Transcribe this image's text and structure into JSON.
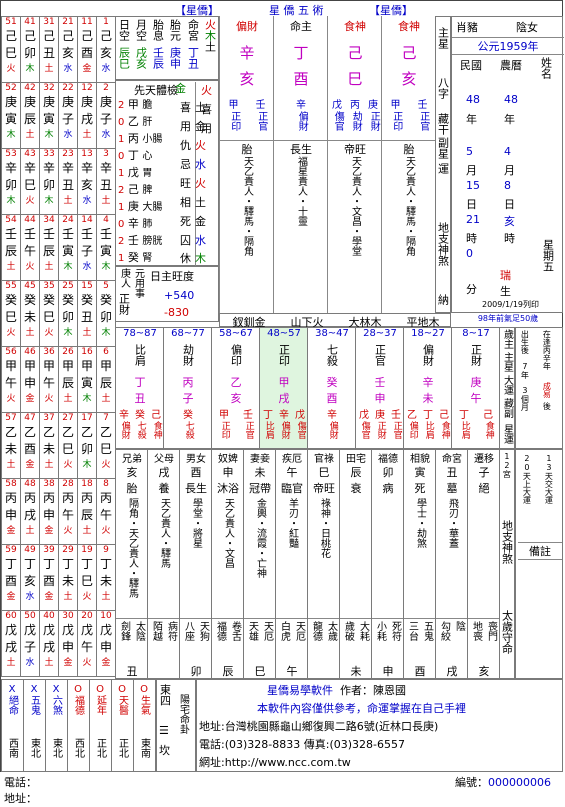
{
  "header": {
    "left_tag": "【星僑】",
    "title": "星  僑  五  術",
    "right_tag": "【星僑】"
  },
  "year_columns": [
    {
      "num": "51",
      "stem": "己",
      "branch": "巳",
      "el": "火"
    },
    {
      "num": "41",
      "stem": "己",
      "branch": "卯",
      "el": "木"
    },
    {
      "num": "31",
      "stem": "己",
      "branch": "丑",
      "el": "土"
    },
    {
      "num": "21",
      "stem": "己",
      "branch": "亥",
      "el": "水"
    },
    {
      "num": "11",
      "stem": "己",
      "branch": "酉",
      "el": "金"
    },
    {
      "num": "1",
      "stem": "己",
      "branch": "亥",
      "el": "水"
    }
  ],
  "left_grid": [
    [
      [
        "52",
        "庚",
        "寅",
        "木"
      ],
      [
        "42",
        "庚",
        "辰",
        "土"
      ],
      [
        "32",
        "庚",
        "寅",
        "木"
      ],
      [
        "22",
        "庚",
        "子",
        "水"
      ],
      [
        "12",
        "庚",
        "戌",
        "土"
      ],
      [
        "2",
        "庚",
        "子",
        "水"
      ]
    ],
    [
      [
        "53",
        "辛",
        "卯",
        "木"
      ],
      [
        "43",
        "辛",
        "巳",
        "火"
      ],
      [
        "33",
        "辛",
        "卯",
        "木"
      ],
      [
        "23",
        "辛",
        "丑",
        "土"
      ],
      [
        "13",
        "辛",
        "亥",
        "水"
      ],
      [
        "3",
        "辛",
        "丑",
        "土"
      ]
    ],
    [
      [
        "54",
        "壬",
        "辰",
        "土"
      ],
      [
        "44",
        "壬",
        "午",
        "火"
      ],
      [
        "34",
        "壬",
        "辰",
        "土"
      ],
      [
        "24",
        "壬",
        "寅",
        "木"
      ],
      [
        "14",
        "壬",
        "子",
        "水"
      ],
      [
        "4",
        "壬",
        "寅",
        "木"
      ]
    ],
    [
      [
        "55",
        "癸",
        "巳",
        "火"
      ],
      [
        "45",
        "癸",
        "未",
        "土"
      ],
      [
        "35",
        "癸",
        "巳",
        "火"
      ],
      [
        "25",
        "癸",
        "卯",
        "木"
      ],
      [
        "15",
        "癸",
        "丑",
        "土"
      ],
      [
        "5",
        "癸",
        "卯",
        "木"
      ]
    ],
    [
      [
        "56",
        "甲",
        "午",
        "火"
      ],
      [
        "46",
        "甲",
        "申",
        "金"
      ],
      [
        "36",
        "甲",
        "午",
        "火"
      ],
      [
        "26",
        "甲",
        "辰",
        "土"
      ],
      [
        "16",
        "甲",
        "寅",
        "木"
      ],
      [
        "6",
        "甲",
        "辰",
        "土"
      ]
    ],
    [
      [
        "57",
        "乙",
        "未",
        "土"
      ],
      [
        "47",
        "乙",
        "酉",
        "金"
      ],
      [
        "37",
        "乙",
        "未",
        "土"
      ],
      [
        "27",
        "乙",
        "巳",
        "火"
      ],
      [
        "17",
        "乙",
        "卯",
        "木"
      ],
      [
        "7",
        "乙",
        "巳",
        "火"
      ]
    ],
    [
      [
        "58",
        "丙",
        "申",
        "金"
      ],
      [
        "48",
        "丙",
        "戌",
        "土"
      ],
      [
        "38",
        "丙",
        "申",
        "金"
      ],
      [
        "28",
        "丙",
        "午",
        "火"
      ],
      [
        "18",
        "丙",
        "辰",
        "土"
      ],
      [
        "8",
        "丙",
        "午",
        "火"
      ]
    ],
    [
      [
        "59",
        "丁",
        "酉",
        "金"
      ],
      [
        "49",
        "丁",
        "亥",
        "水"
      ],
      [
        "39",
        "丁",
        "酉",
        "金"
      ],
      [
        "29",
        "丁",
        "未",
        "土"
      ],
      [
        "19",
        "丁",
        "巳",
        "火"
      ],
      [
        "9",
        "丁",
        "未",
        "土"
      ]
    ],
    [
      [
        "60",
        "戊",
        "戌",
        "土"
      ],
      [
        "50",
        "戊",
        "子",
        "水"
      ],
      [
        "40",
        "戊",
        "戌",
        "土"
      ],
      [
        "30",
        "戊",
        "申",
        "金"
      ],
      [
        "20",
        "戊",
        "午",
        "火"
      ],
      [
        "10",
        "戊",
        "申",
        "金"
      ]
    ]
  ],
  "info_cols": {
    "rikong": "日空",
    "rikong_vals": "辰巳",
    "yuekong": "月空",
    "yuekong_vals": "戌亥",
    "taixi": "胎息",
    "taixi_vals": "壬辰",
    "taiyuan": "胎元",
    "taiyuan_vals": "庚申",
    "minggong": "命宮",
    "minggong_vals": "丁丑"
  },
  "wuxing": [
    {
      "e": "火",
      "n": ""
    },
    {
      "e": "木",
      "n": ""
    },
    {
      "e": "土",
      "n": ""
    },
    {
      "e": "水",
      "n": ""
    },
    {
      "e": "金",
      "n": ""
    }
  ],
  "xiantian": {
    "title": "先天體檢",
    "stems": [
      "甲",
      "乙",
      "丙",
      "丁",
      "戊",
      "己",
      "庚",
      "辛",
      "壬",
      "癸"
    ],
    "nums": [
      "2",
      "0",
      "1",
      "0",
      "1",
      "2",
      "1",
      "0",
      "2",
      "1"
    ],
    "organs": [
      "膽",
      "肝",
      "小腸",
      "心",
      "胃",
      "脾",
      "大腸",
      "肺",
      "膀胱",
      "腎"
    ]
  },
  "xiji": {
    "xi": "喜",
    "yong": "用",
    "chou": "仇",
    "ji": "忌",
    "xi_e": "土",
    "yong_e": "金",
    "chou_e": "火",
    "ji_e": "水"
  },
  "wangxiang": {
    "wang": "旺",
    "xiang": "相",
    "si": "死",
    "qiu": "囚",
    "xiu": "休",
    "wang_e": "火",
    "xiang_e": "土",
    "si_e": "金",
    "qiu_e": "水",
    "xiu_e": "木"
  },
  "yuanyong": {
    "label1": "庚",
    "label2": "人",
    "label3": "元",
    "label4": "用",
    "label5": "事"
  },
  "rizhu": {
    "title": "日主旺度",
    "plus": "+540",
    "minus": "-830",
    "zhengcai": "正財"
  },
  "pillars": [
    {
      "god": "偏財",
      "stem": "辛",
      "branch": "亥",
      "god_color": "red",
      "hidden": [
        [
          "甲",
          "正印"
        ],
        [
          "壬",
          "正官"
        ]
      ],
      "stage": "胎",
      "stars": [
        "天乙貴人",
        "驛馬",
        "隔角"
      ]
    },
    {
      "god": "命主",
      "stem": "丁",
      "branch": "酉",
      "god_color": "black",
      "hidden": [
        [
          "辛",
          "偏財"
        ]
      ],
      "stage": "長生",
      "stars": [
        "福星貴人",
        "十靈"
      ]
    },
    {
      "god": "食神",
      "stem": "己",
      "branch": "巳",
      "god_color": "red",
      "hidden": [
        [
          "戊",
          "傷官"
        ],
        [
          "丙",
          "劫財"
        ],
        [
          "庚",
          "正財"
        ]
      ],
      "stage": "帝旺",
      "stars": [
        "天乙貴人",
        "文昌",
        "學堂"
      ]
    },
    {
      "god": "食神",
      "stem": "己",
      "branch": "亥",
      "god_color": "red",
      "hidden": [
        [
          "甲",
          "正印"
        ],
        [
          "壬",
          "正官"
        ]
      ],
      "stage": "胎",
      "stars": [
        "天乙貴人",
        "驛馬",
        "隔角"
      ]
    }
  ],
  "side_labels": {
    "zhuxing": "主星",
    "bazi": "八字",
    "canggan": "藏干",
    "fuxing": "副星",
    "yun": "運",
    "shensha": "地支神煞",
    "nayin": "納"
  },
  "nayin": [
    "釵釧金",
    "山下火",
    "大林木",
    "平地木"
  ],
  "person": {
    "shengxiao": "肖豬",
    "gender": "陰女",
    "year_ce": "公元1959年",
    "minguo": "民國",
    "nongli": "農曆",
    "name": "姓名",
    "mg_year": "48",
    "mg_nian": "年",
    "mg_month": "5",
    "mg_yue": "月",
    "mg_day": "15",
    "mg_ri": "日",
    "mg_hour": "21",
    "mg_shi": "時",
    "mg_min": "0",
    "mg_fen": "分",
    "nl_year": "48",
    "nl_nian": "年",
    "nl_month": "4",
    "nl_yue": "月",
    "nl_day": "8",
    "nl_ri": "日",
    "nl_hour": "亥",
    "nl_shi": "時",
    "rui": "瑞",
    "sheng": "生",
    "xingqi": "星期五",
    "date": "2009/1/19列印",
    "jieqi": "98年前氣足50歲"
  },
  "dayun": [
    {
      "age": "78~87",
      "god": "比肩",
      "stem": "丁",
      "branch": "丑",
      "hidden": [
        [
          "辛",
          "偏財"
        ],
        [
          "癸",
          "七殺"
        ],
        [
          "己",
          "食神"
        ]
      ],
      "stage": "墓",
      "stars": [
        "天乙貴人",
        "驛馬"
      ],
      "hl": false
    },
    {
      "age": "68~77",
      "god": "劫財",
      "stem": "丙",
      "branch": "子",
      "hidden": [
        [
          "癸",
          "七殺"
        ]
      ],
      "stage": "絕",
      "stars": [
        "天德"
      ],
      "hl": false
    },
    {
      "age": "58~67",
      "god": "偏印",
      "stem": "乙",
      "branch": "亥",
      "hidden": [
        [
          "甲",
          "正印"
        ],
        [
          "壬",
          "正官"
        ]
      ],
      "stage": "胎",
      "stars": [
        "天德",
        "天乙貴人"
      ],
      "hl": false
    },
    {
      "age": "48~57",
      "god": "正印",
      "stem": "甲",
      "branch": "戌",
      "hidden": [
        [
          "丁",
          "比肩"
        ],
        [
          "辛",
          "偏財"
        ],
        [
          "戊",
          "傷官"
        ]
      ],
      "stage": "養",
      "stars": [
        "福星",
        "十靈"
      ],
      "hl": true
    },
    {
      "age": "38~47",
      "god": "七殺",
      "stem": "癸",
      "branch": "酉",
      "hidden": [
        [
          "辛",
          "偏財"
        ]
      ],
      "stage": "長生",
      "stars": [
        "文昌",
        "學堂"
      ],
      "hl": false
    },
    {
      "age": "28~37",
      "god": "正官",
      "stem": "壬",
      "branch": "申",
      "hidden": [
        [
          "戊",
          "傷官"
        ],
        [
          "庚",
          "正財"
        ],
        [
          "壬",
          "正官"
        ]
      ],
      "stage": "沐浴",
      "stars": [
        "天乙貴人"
      ],
      "hl": false
    },
    {
      "age": "18~27",
      "god": "偏財",
      "stem": "辛",
      "branch": "未",
      "hidden": [
        [
          "乙",
          "偏印"
        ],
        [
          "丁",
          "比肩"
        ],
        [
          "己",
          "食神"
        ]
      ],
      "stage": "冠帶",
      "stars": [
        "驛馬"
      ],
      "hl": false
    },
    {
      "age": "8~17",
      "god": "正財",
      "stem": "庚",
      "branch": "午",
      "hidden": [
        [
          "丁",
          "比肩"
        ],
        [
          "己",
          "食神"
        ]
      ],
      "stage": "臨官",
      "stars": [
        "天德"
      ],
      "hl": false
    }
  ],
  "dayun_side": {
    "suizhu": "歲主",
    "zhuxing": "主星",
    "dayun": "大運",
    "canggan": "藏副",
    "yun": "星運"
  },
  "birth_info": {
    "col1": "出生後",
    "col1b": "7年",
    "col1c": "3個月",
    "col1d": "20天上大運",
    "col2": "在逢丙辛年",
    "col2b": "成易",
    "col2c": "後",
    "col2d": "13天交大運"
  },
  "palaces": [
    {
      "name": "兄弟",
      "branch": "亥",
      "stage": "胎",
      "stars": [
        "隔角",
        "天乙貴人",
        "驛馬"
      ],
      "bottom": [
        "劍鋒",
        "太陰"
      ],
      "b2": "丑"
    },
    {
      "name": "父母",
      "branch": "戌",
      "stage": "養",
      "stars": [
        "天乙貴人",
        "驛馬"
      ],
      "bottom": [
        "陌越",
        "病符"
      ],
      "b2": ""
    },
    {
      "name": "男女",
      "branch": "酉",
      "stage": "長生",
      "stars": [
        "學堂",
        "將星"
      ],
      "bottom": [
        "八座",
        "天狗"
      ],
      "b2": "卯"
    },
    {
      "name": "奴婢",
      "branch": "申",
      "stage": "沐浴",
      "stars": [
        "天乙貴人",
        "文昌"
      ],
      "bottom": [
        "福德",
        "卷舌"
      ],
      "b2": "辰"
    },
    {
      "name": "妻妾",
      "branch": "未",
      "stage": "冠帶",
      "stars": [
        "金輿",
        "流霞",
        "亡神"
      ],
      "bottom": [
        "天雄",
        "天厄"
      ],
      "b2": "巳"
    },
    {
      "name": "疾厄",
      "branch": "午",
      "stage": "臨官",
      "stars": [
        "羊刃",
        "紅豔"
      ],
      "bottom": [
        "白虎",
        "天厄"
      ],
      "b2": "午"
    },
    {
      "name": "官祿",
      "branch": "巳",
      "stage": "帝旺",
      "stars": [
        "祿神",
        "日桃花"
      ],
      "bottom": [
        "龍德",
        "太歲"
      ],
      "b2": ""
    },
    {
      "name": "田宅",
      "branch": "辰",
      "stage": "衰",
      "stars": [],
      "bottom": [
        "歲破",
        "大耗"
      ],
      "b2": "未"
    },
    {
      "name": "福德",
      "branch": "卯",
      "stage": "病",
      "stars": [],
      "bottom": [
        "小耗",
        "死符"
      ],
      "b2": "申"
    },
    {
      "name": "相貌",
      "branch": "寅",
      "stage": "死",
      "stars": [
        "學士",
        "劫煞"
      ],
      "bottom": [
        "三台",
        "五鬼"
      ],
      "b2": "酉"
    },
    {
      "name": "命宮",
      "branch": "丑",
      "stage": "墓",
      "stars": [
        "飛刃",
        "華蓋"
      ],
      "bottom": [
        "勾絞",
        "陰"
      ],
      "b2": "戌"
    },
    {
      "name": "遷移",
      "branch": "子",
      "stage": "絕",
      "stars": [],
      "bottom": [
        "地喪",
        "喪門"
      ],
      "b2": "亥"
    }
  ],
  "palace_side": {
    "a": "12宮",
    "b": "地支神煞",
    "beizhu": "備註",
    "c": "太歲守命"
  },
  "bottom_dirs": [
    {
      "t": "X絕命",
      "d": "西南"
    },
    {
      "t": "X五鬼",
      "d": "東北"
    },
    {
      "t": "X六煞",
      "d": "東北"
    },
    {
      "t": "O福德",
      "d": "西北"
    },
    {
      "t": "O延年",
      "d": "正北"
    },
    {
      "t": "O天醫",
      "d": "正北"
    },
    {
      "t": "O生氣",
      "d": "東南"
    }
  ],
  "zhai": {
    "dong": "東四",
    "yang": "陽宅命卦",
    "kan": "坎",
    "line": "☰"
  },
  "footer": {
    "soft": "星僑易學軟件",
    "author_label": "作者：",
    "author": "陳恩國",
    "notice": "本軟件內容僅供參考，命運掌握在自己手裡",
    "addr_label": "地址:",
    "addr": "台灣桃園縣龜山鄉復興二路6號(近林口長庚)",
    "tel_label": "電話:",
    "tel": "(03)328-8833 傳真:(03)328-6557",
    "web_label": "網址:",
    "web": "http://www.ncc.com.tw",
    "phone": "電話：",
    "address": "地址：",
    "serial_label": "編號：",
    "serial": "000000006"
  }
}
